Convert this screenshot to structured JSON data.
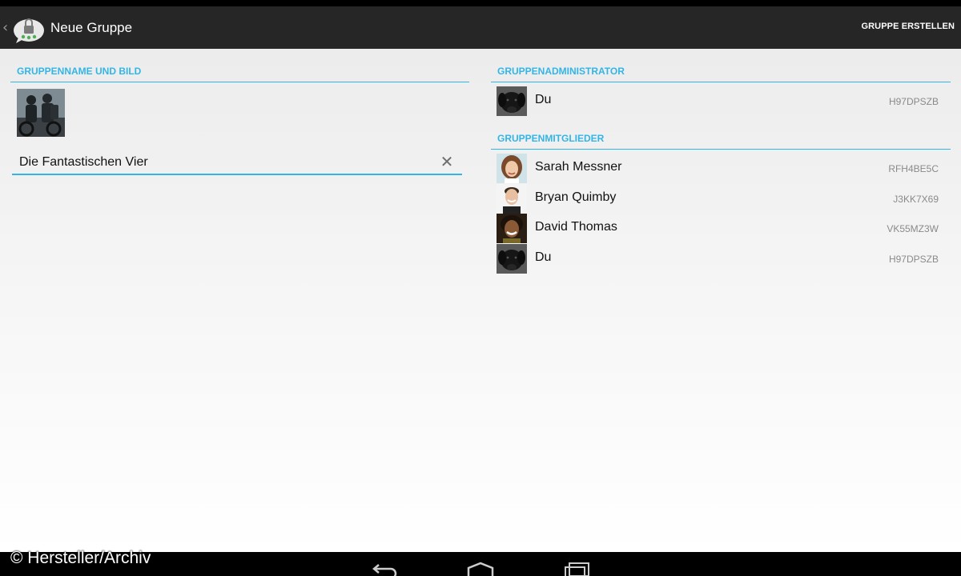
{
  "action_bar": {
    "up_caret": "‹",
    "title": "Neue Gruppe",
    "create_action": "GRUPPE ERSTELLEN"
  },
  "left_panel": {
    "section_title": "GRUPPENNAME UND BILD",
    "group_name_value": "Die Fantastischen Vier",
    "clear_icon": "✕"
  },
  "admin_section": {
    "title": "GRUPPENADMINISTRATOR",
    "admin": {
      "name": "Du",
      "id": "H97DPSZB"
    }
  },
  "members_section": {
    "title": "GRUPPENMITGLIEDER",
    "members": [
      {
        "name": "Sarah Messner",
        "id": "RFH4BE5C"
      },
      {
        "name": "Bryan Quimby",
        "id": "J3KK7X69"
      },
      {
        "name": "David Thomas",
        "id": "VK55MZ3W"
      },
      {
        "name": "Du",
        "id": "H97DPSZB"
      }
    ]
  },
  "footer": {
    "copyright": "© Hersteller/Archiv"
  },
  "colors": {
    "accent": "#33b5e5",
    "action_bar": "#262626"
  }
}
